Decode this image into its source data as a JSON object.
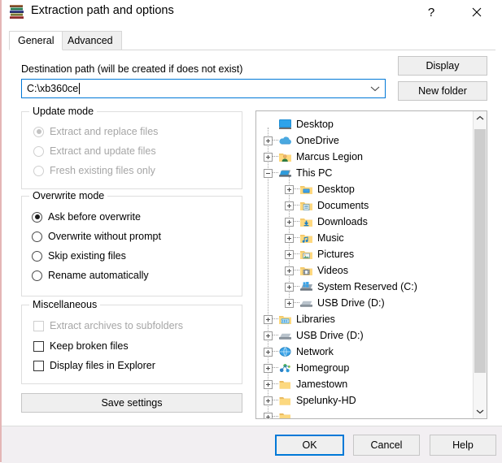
{
  "window": {
    "title": "Extraction path and options",
    "icon": "winrar-books-icon",
    "help_button": "?",
    "close_button": "✕"
  },
  "tabs": [
    {
      "label": "General",
      "active": true
    },
    {
      "label": "Advanced",
      "active": false
    }
  ],
  "destination": {
    "label": "Destination path (will be created if does not exist)",
    "value": "C:\\xb360ce",
    "dropdown_icon": "chevron-down-icon"
  },
  "side_buttons": {
    "display": "Display",
    "new_folder": "New folder"
  },
  "update_mode": {
    "title": "Update mode",
    "enabled": false,
    "options": [
      {
        "label": "Extract and replace files",
        "checked": true
      },
      {
        "label": "Extract and update files",
        "checked": false
      },
      {
        "label": "Fresh existing files only",
        "checked": false
      }
    ]
  },
  "overwrite_mode": {
    "title": "Overwrite mode",
    "enabled": true,
    "options": [
      {
        "label": "Ask before overwrite",
        "checked": true
      },
      {
        "label": "Overwrite without prompt",
        "checked": false
      },
      {
        "label": "Skip existing files",
        "checked": false
      },
      {
        "label": "Rename automatically",
        "checked": false
      }
    ]
  },
  "miscellaneous": {
    "title": "Miscellaneous",
    "options": [
      {
        "label": "Extract archives to subfolders",
        "checked": false,
        "enabled": false
      },
      {
        "label": "Keep broken files",
        "checked": false,
        "enabled": true
      },
      {
        "label": "Display files in Explorer",
        "checked": false,
        "enabled": true
      }
    ]
  },
  "save_settings_button": "Save settings",
  "folder_tree": {
    "items": [
      {
        "label": "Desktop",
        "depth": 0,
        "expander": "none",
        "icon": "monitor-icon"
      },
      {
        "label": "OneDrive",
        "depth": 0,
        "expander": "plus",
        "icon": "cloud-icon"
      },
      {
        "label": "Marcus Legion",
        "depth": 0,
        "expander": "plus",
        "icon": "user-folder-icon"
      },
      {
        "label": "This PC",
        "depth": 0,
        "expander": "minus",
        "icon": "this-pc-icon"
      },
      {
        "label": "Desktop",
        "depth": 1,
        "expander": "plus",
        "icon": "desktop-folder-icon"
      },
      {
        "label": "Documents",
        "depth": 1,
        "expander": "plus",
        "icon": "documents-folder-icon"
      },
      {
        "label": "Downloads",
        "depth": 1,
        "expander": "plus",
        "icon": "downloads-folder-icon"
      },
      {
        "label": "Music",
        "depth": 1,
        "expander": "plus",
        "icon": "music-folder-icon"
      },
      {
        "label": "Pictures",
        "depth": 1,
        "expander": "plus",
        "icon": "pictures-folder-icon"
      },
      {
        "label": "Videos",
        "depth": 1,
        "expander": "plus",
        "icon": "videos-folder-icon"
      },
      {
        "label": "System Reserved (C:)",
        "depth": 1,
        "expander": "plus",
        "icon": "windows-drive-icon"
      },
      {
        "label": "USB Drive (D:)",
        "depth": 1,
        "expander": "plus",
        "icon": "usb-drive-icon"
      },
      {
        "label": "Libraries",
        "depth": 0,
        "expander": "plus",
        "icon": "libraries-icon"
      },
      {
        "label": "USB Drive (D:)",
        "depth": 0,
        "expander": "plus",
        "icon": "usb-drive-icon"
      },
      {
        "label": "Network",
        "depth": 0,
        "expander": "plus",
        "icon": "network-icon"
      },
      {
        "label": "Homegroup",
        "depth": 0,
        "expander": "plus",
        "icon": "homegroup-icon"
      },
      {
        "label": "Jamestown",
        "depth": 0,
        "expander": "plus",
        "icon": "folder-icon"
      },
      {
        "label": "Spelunky-HD",
        "depth": 0,
        "expander": "plus",
        "icon": "folder-icon"
      },
      {
        "label": "",
        "depth": 0,
        "expander": "plus",
        "icon": "folder-icon"
      }
    ],
    "scrollbar": {
      "up_icon": "chevron-up-icon",
      "down_icon": "chevron-down-icon"
    }
  },
  "footer_buttons": {
    "ok": "OK",
    "cancel": "Cancel",
    "help": "Help"
  },
  "colors": {
    "accent": "#0078d7",
    "dialog_bg": "#ffffff",
    "footer_bg": "#f2eff2",
    "button_face": "#efefef",
    "disabled_text": "#a6a6a6"
  }
}
